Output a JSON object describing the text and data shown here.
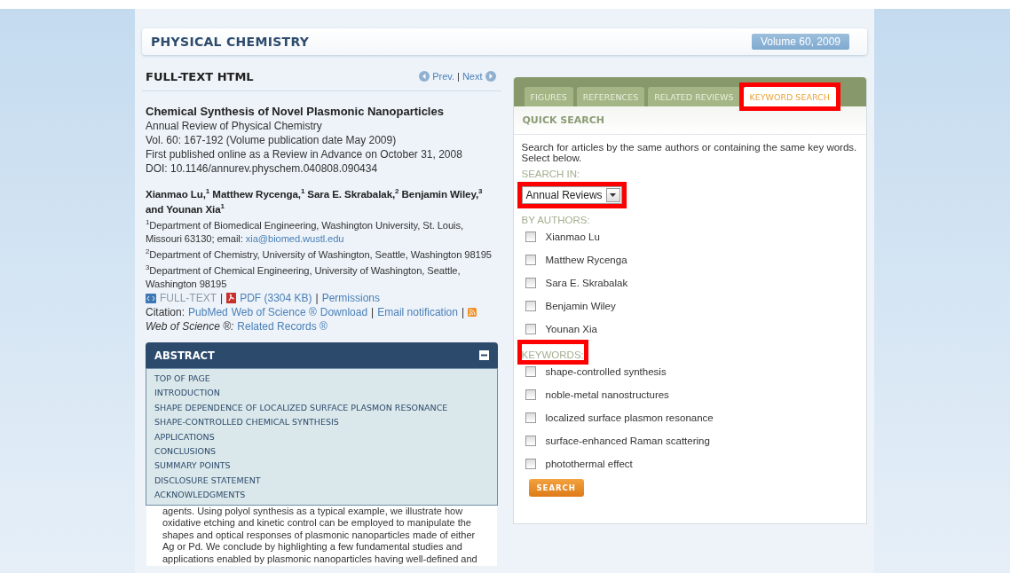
{
  "journal": {
    "title": "PHYSICAL CHEMISTRY",
    "volume": "Volume 60, 2009"
  },
  "article": {
    "section_title": "FULL-TEXT HTML",
    "nav": [
      {
        "kind": "prev",
        "label": "Prev."
      },
      {
        "kind": "sep",
        "label": "|"
      },
      {
        "kind": "next",
        "label": "Next"
      }
    ],
    "title": "Chemical Synthesis of Novel Plasmonic Nanoparticles",
    "meta": [
      "Annual Review of Physical Chemistry",
      "Vol. 60: 167-192 (Volume publication date May 2009)",
      "First published online as a Review in Advance on October 31, 2008",
      "DOI: 10.1146/annurev.physchem.040808.090434"
    ],
    "authors": "Xianmao Lu,$^{1}$ Matthew Rycenga,$^{1}$ Sara E. Skrabalak,$^{2}$ Benjamin Wiley,$^{3}$ and Younan Xia$^{1}$",
    "affiliations": [
      {
        "text": "$^{1}$Department of Biomedical Engineering, Washington University, St. Louis, Missouri 63130; email:",
        "email": "xia@biomed.wustl.edu"
      },
      {
        "text": "$^{2}$Department of Chemistry, University of Washington, Seattle, Washington 98195"
      },
      {
        "text": "$^{3}$Department of Chemical Engineering, University of Washington, Seattle, Washington 98195"
      }
    ],
    "link_lines": [
      [
        {
          "kind": "fulltext",
          "label": "FULL-TEXT",
          "disabled": true
        },
        {
          "kind": "sep",
          "label": "|"
        },
        {
          "kind": "pdf",
          "label": "PDF (3304 KB)",
          "disabled": false
        },
        {
          "kind": "sep",
          "label": "|"
        },
        {
          "kind": "link",
          "label": "Permissions",
          "disabled": false
        }
      ],
      [
        {
          "kind": "text",
          "label": "Citation:"
        },
        {
          "kind": "link",
          "label": "PubMed",
          "disabled": false
        },
        {
          "kind": "link",
          "label": "Web of Science ®",
          "disabled": false
        },
        {
          "kind": "link",
          "label": "Download",
          "disabled": false
        },
        {
          "kind": "sep",
          "label": "|"
        },
        {
          "kind": "link",
          "label": "Email notification",
          "disabled": false
        },
        {
          "kind": "sep",
          "label": "|"
        },
        {
          "kind": "rss"
        }
      ],
      [
        {
          "kind": "italic",
          "label": "Web of Science ®:"
        },
        {
          "kind": "link",
          "label": "Related Records ®",
          "disabled": false
        }
      ]
    ],
    "abstract": {
      "title": "ABSTRACT",
      "expanded": true,
      "menu": [
        "TOP OF PAGE",
        "INTRODUCTION",
        "SHAPE DEPENDENCE OF LOCALIZED SURFACE PLASMON RESONANCE",
        "SHAPE-CONTROLLED CHEMICAL SYNTHESIS",
        "APPLICATIONS",
        "CONCLUSIONS",
        "SUMMARY POINTS",
        "DISCLOSURE STATEMENT",
        "ACKNOWLEDGMENTS"
      ],
      "text": "agents. Using polyol synthesis as a typical example, we illustrate how oxidative etching and kinetic control can be employed to manipulate the shapes and optical responses of plasmonic nanoparticles made of either Ag or Pd. We conclude by highlighting a few fundamental studies and applications enabled by plasmonic nanoparticles having well-defined and"
    }
  },
  "search_panel": {
    "tabs": [
      {
        "label": "FIGURES",
        "selected": false,
        "highlighted": false
      },
      {
        "label": "REFERENCES",
        "selected": false,
        "highlighted": false
      },
      {
        "label": "RELATED REVIEWS",
        "selected": false,
        "highlighted": false
      },
      {
        "label": "KEYWORD SEARCH",
        "selected": true,
        "highlighted": true
      }
    ],
    "title": "QUICK SEARCH",
    "intro": "Search for articles by the same authors or containing the same key words. Select below.",
    "search_in": {
      "label": "SEARCH IN:",
      "value": "Annual Reviews",
      "highlighted": true
    },
    "authors": {
      "label": "BY AUTHORS:",
      "highlighted": false,
      "items": [
        {
          "label": "Xianmao Lu",
          "checked": false
        },
        {
          "label": "Matthew Rycenga",
          "checked": false
        },
        {
          "label": "Sara E. Skrabalak",
          "checked": false
        },
        {
          "label": "Benjamin Wiley",
          "checked": false
        },
        {
          "label": "Younan Xia",
          "checked": false
        }
      ]
    },
    "keywords": {
      "label": "KEYWORDS:",
      "highlighted": true,
      "items": [
        {
          "label": "shape-controlled synthesis",
          "checked": false
        },
        {
          "label": "noble-metal nanostructures",
          "checked": false
        },
        {
          "label": "localized surface plasmon resonance",
          "checked": false
        },
        {
          "label": "surface-enhanced Raman scattering",
          "checked": false
        },
        {
          "label": "photothermal effect",
          "checked": false
        }
      ]
    },
    "button": "SEARCH"
  }
}
